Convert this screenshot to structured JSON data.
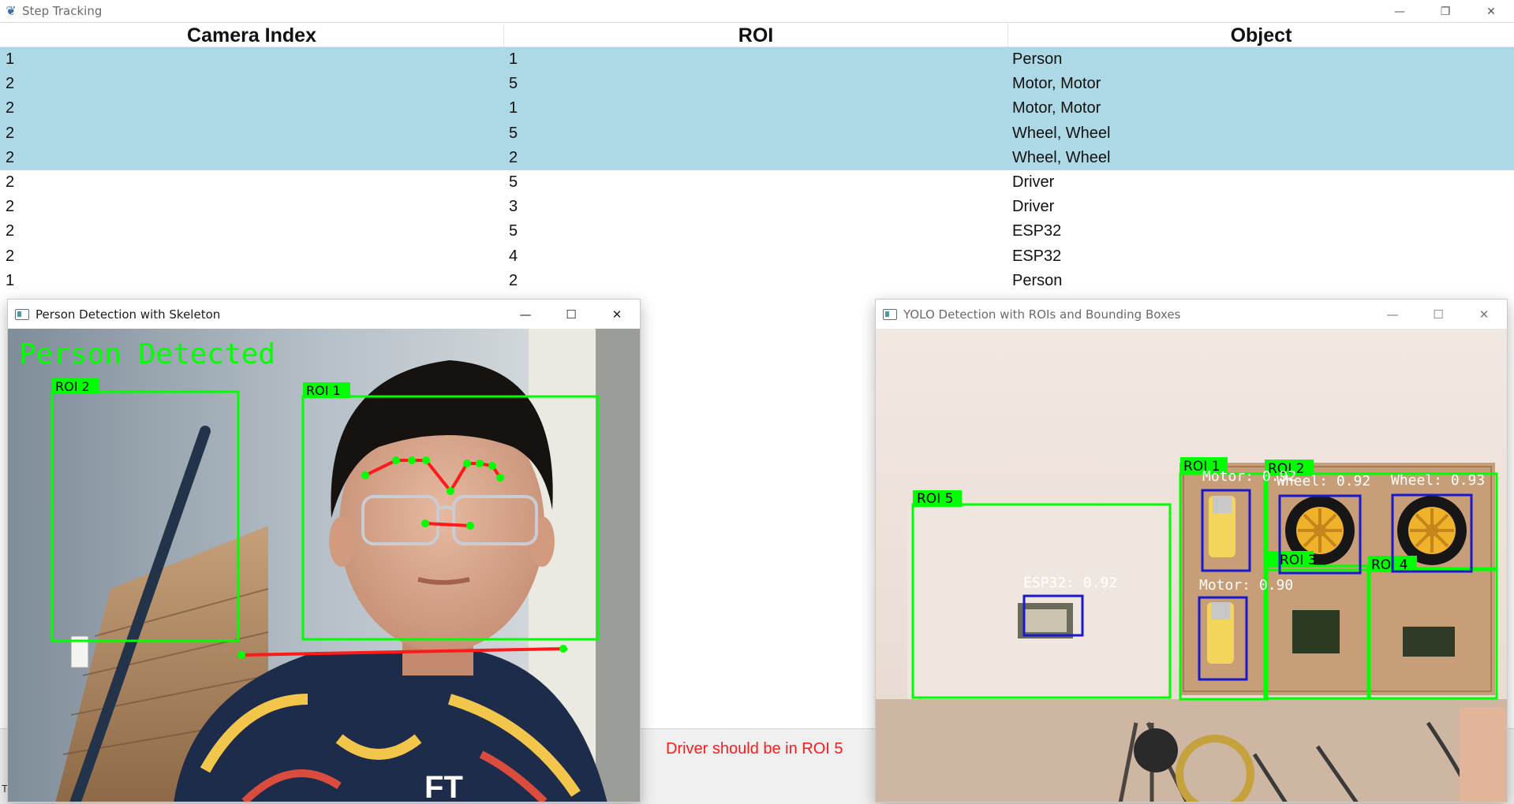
{
  "window": {
    "title": "Step Tracking",
    "app_icon": "feather-icon",
    "controls": {
      "minimize": "—",
      "restore": "❐",
      "close": "✕"
    }
  },
  "table": {
    "headers": [
      "Camera Index",
      "ROI",
      "Object"
    ],
    "rows": [
      {
        "camera": "1",
        "roi": "1",
        "object": "Person",
        "selected": true
      },
      {
        "camera": "2",
        "roi": "5",
        "object": "Motor, Motor",
        "selected": true
      },
      {
        "camera": "2",
        "roi": "1",
        "object": "Motor, Motor",
        "selected": true
      },
      {
        "camera": "2",
        "roi": "5",
        "object": "Wheel, Wheel",
        "selected": true
      },
      {
        "camera": "2",
        "roi": "2",
        "object": "Wheel, Wheel",
        "selected": true
      },
      {
        "camera": "2",
        "roi": "5",
        "object": "Driver",
        "selected": false
      },
      {
        "camera": "2",
        "roi": "3",
        "object": "Driver",
        "selected": false
      },
      {
        "camera": "2",
        "roi": "5",
        "object": "ESP32",
        "selected": false
      },
      {
        "camera": "2",
        "roi": "4",
        "object": "ESP32",
        "selected": false
      },
      {
        "camera": "1",
        "roi": "2",
        "object": "Person",
        "selected": false
      }
    ],
    "selected_color": "#add8e6"
  },
  "status": {
    "message": "Driver should be in ROI 5",
    "color": "#ff1a1a",
    "corner_text": "T"
  },
  "person_window": {
    "title": "Person Detection with Skeleton",
    "banner": "Person Detected",
    "roi_labels": [
      "ROI 2",
      "ROI 1"
    ],
    "roi_color": "#00ff00",
    "skeleton_color": "#ff1a1a"
  },
  "yolo_window": {
    "title": "YOLO Detection with ROIs and Bounding Boxes",
    "roi_labels": [
      "ROI 1",
      "ROI 2",
      "ROI 3",
      "ROI 4",
      "ROI 5"
    ],
    "detections": [
      "Motor: 0.92",
      "Wheel: 0.92",
      "Wheel: 0.93",
      "Motor: 0.90",
      "ESP32: 0.92"
    ],
    "roi_color": "#00ff00",
    "box_color": "#1a1acc"
  }
}
